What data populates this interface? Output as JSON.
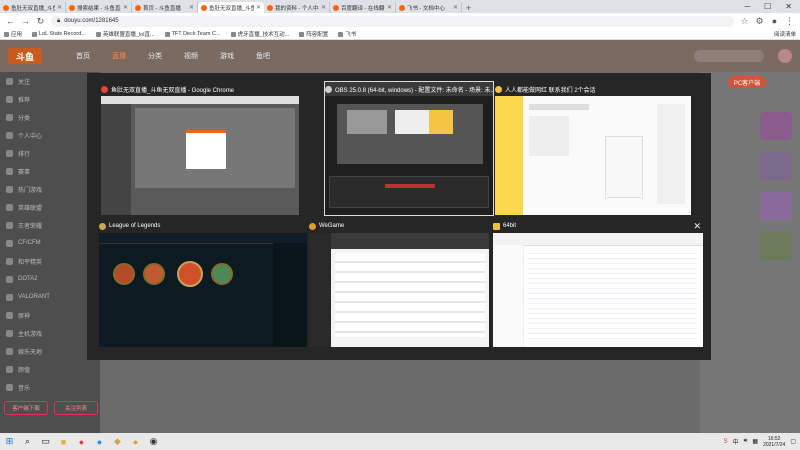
{
  "browser": {
    "tabs": [
      {
        "label": "鱼肚无双直播_斗鱼无双直播",
        "active": false
      },
      {
        "label": "搜索结果 - 斗鱼直播",
        "active": false
      },
      {
        "label": "首页 - 斗鱼直播",
        "active": false
      },
      {
        "label": "鱼肚无双直播_斗鱼无双直播",
        "active": true
      },
      {
        "label": "我的资料 - 个人中心",
        "active": false
      },
      {
        "label": "百度翻译 - 在线翻译",
        "active": false
      },
      {
        "label": "飞书 - 文档中心",
        "active": false
      }
    ],
    "new_tab": "+",
    "url": "douyu.com/1281645",
    "bookmarks": [
      "应用",
      "LoL Stats Record...",
      "英雄联盟直播_lol直...",
      "TFT Deck Team C...",
      "虎牙直播_技术互动...",
      "阵容配置",
      "飞书"
    ],
    "bookmark_right": "阅读清单"
  },
  "site": {
    "logo": "斗鱼",
    "nav": [
      "首页",
      "直播",
      "分类",
      "视频",
      "游戏",
      "鱼吧"
    ],
    "sidebar": [
      "关注",
      "推荐",
      "分类",
      "个人中心",
      "排行",
      "赛事",
      "热门游戏",
      "英雄联盟",
      "王者荣耀",
      "CF/CFM",
      "和平精英",
      "DOTA2",
      "VALORANT",
      "原神",
      "主机游戏",
      "娱乐天地",
      "颜值",
      "音乐",
      "户外",
      "科技",
      "二次元",
      "星秀",
      "舞蹈"
    ],
    "sidebar_buttons": [
      "客户端下载",
      "关注列表"
    ],
    "pc_button": "PC客户端"
  },
  "switcher": {
    "windows": [
      {
        "title": "鱼肚无双直播_斗鱼无双直播 - Google Chrome",
        "icon_color": "#e94235"
      },
      {
        "title": "OBS 25.0.8 (64-bit, windows) - 配置文件: 未命名 - 场景: 未...",
        "icon_color": "#cfcfcf"
      },
      {
        "title": "人人都能做网红 联系我们 2个会话",
        "icon_color": "#f4c542"
      },
      {
        "title": "League of Legends",
        "icon_color": "#c9a45b"
      },
      {
        "title": "WeGame",
        "icon_color": "#e0a030"
      },
      {
        "title": "64bit",
        "icon_color": "#f0c040"
      }
    ],
    "close_label": "✕"
  },
  "taskbar": {
    "search_icon": "⌕",
    "tray_text": "中",
    "time": "16:52",
    "date": "2021/7/24"
  }
}
